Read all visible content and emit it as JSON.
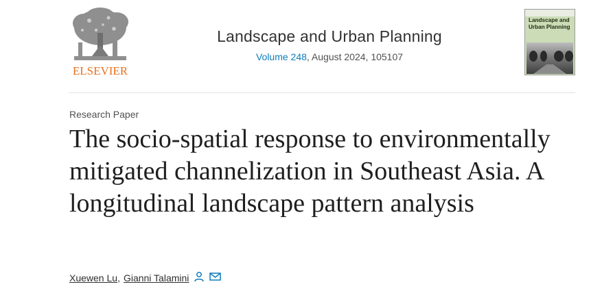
{
  "publisher": {
    "logo_word": "ELSEVIER",
    "logo_icon": "elsevier-tree-icon",
    "color": "#e9711c"
  },
  "journal": {
    "title": "Landscape and Urban Planning",
    "volume_link": "Volume 248",
    "issue_rest": ", August 2024, 105107",
    "link_color": "#0c7dbb"
  },
  "cover": {
    "title": "Landscape and Urban Planning",
    "icon": "journal-cover-image"
  },
  "article": {
    "type": "Research Paper",
    "title": "The socio-spatial response to environmentally mitigated channelization in Southeast Asia. A longitudinal landscape pattern analysis"
  },
  "authors": [
    {
      "name": "Xuewen Lu"
    },
    {
      "name": "Gianni Talamini"
    }
  ],
  "author_separator": ",",
  "author_icons": [
    "person-icon",
    "envelope-icon"
  ]
}
